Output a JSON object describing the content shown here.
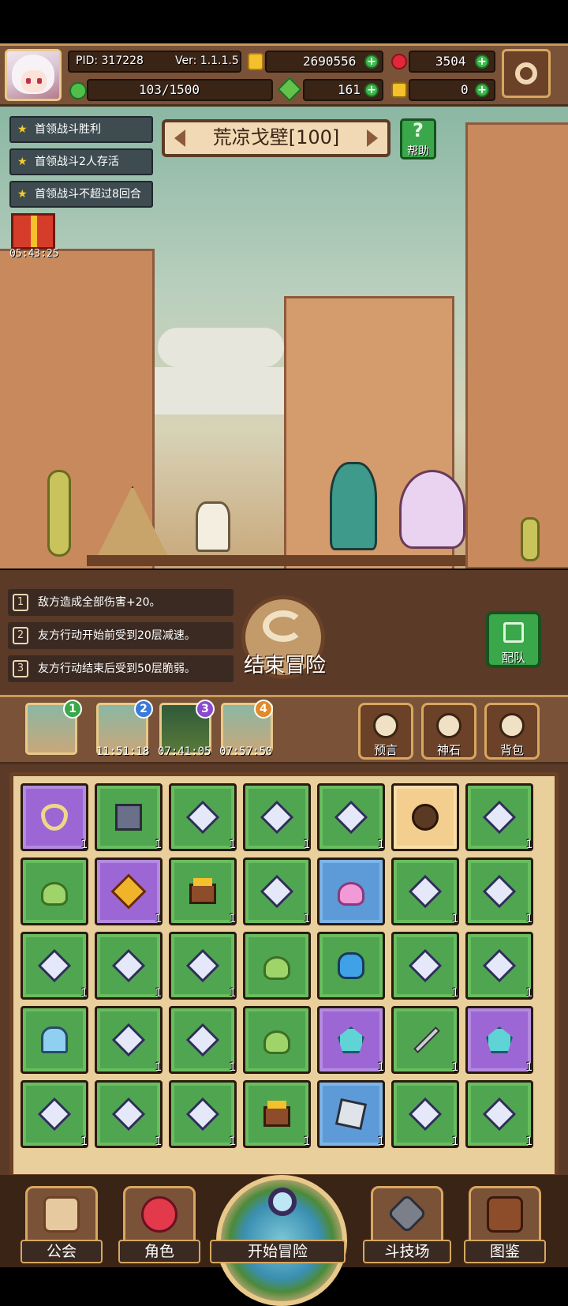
{
  "hud": {
    "pid": "PID: 317228",
    "version": "Ver: 1.1.1.5",
    "gold": "2690556",
    "gems": "3504",
    "energy": "103/1500",
    "clover": "161",
    "key": "0"
  },
  "quests": [
    {
      "label": "首领战斗胜利"
    },
    {
      "label": "首领战斗2人存活"
    },
    {
      "label": "首领战斗不超过8回合"
    }
  ],
  "stage": {
    "title": "荒凉戈壁[100]",
    "help_label": "帮助"
  },
  "gift_timer": "05:43:25",
  "rules": [
    {
      "n": "1",
      "text": "敌方造成全部伤害+20。"
    },
    {
      "n": "2",
      "text": "友方行动开始前受到20层减速。"
    },
    {
      "n": "3",
      "text": "友方行动结束后受到50层脆弱。"
    }
  ],
  "end_label": "结束冒险",
  "team_label": "配队",
  "slots": [
    {
      "n": "1",
      "timer": ""
    },
    {
      "n": "2",
      "timer": "11:51:18"
    },
    {
      "n": "3",
      "timer": "07:41:05"
    },
    {
      "n": "4",
      "timer": "07:57:50"
    }
  ],
  "side_buttons": [
    {
      "label": "预言"
    },
    {
      "label": "神石"
    },
    {
      "label": "背包"
    }
  ],
  "inventory": [
    {
      "bg": "purple",
      "icon": "necklace",
      "count": "1"
    },
    {
      "bg": "green",
      "icon": "book",
      "count": "1"
    },
    {
      "bg": "green",
      "icon": "crystal",
      "count": "1"
    },
    {
      "bg": "green",
      "icon": "crystal",
      "count": "1"
    },
    {
      "bg": "green",
      "icon": "crystal",
      "count": "1"
    },
    {
      "bg": "tan",
      "icon": "pot",
      "count": ""
    },
    {
      "bg": "green",
      "icon": "crystal",
      "count": "1"
    },
    {
      "bg": "green",
      "icon": "slime",
      "count": ""
    },
    {
      "bg": "purple",
      "icon": "gem4",
      "count": "1"
    },
    {
      "bg": "green",
      "icon": "chest",
      "count": "1"
    },
    {
      "bg": "green",
      "icon": "crystal",
      "count": "1"
    },
    {
      "bg": "blue",
      "icon": "slime-pink",
      "count": ""
    },
    {
      "bg": "green",
      "icon": "crystal",
      "count": "1"
    },
    {
      "bg": "green",
      "icon": "crystal",
      "count": "1"
    },
    {
      "bg": "green",
      "icon": "crystal",
      "count": "1"
    },
    {
      "bg": "green",
      "icon": "crystal",
      "count": "1"
    },
    {
      "bg": "green",
      "icon": "crystal",
      "count": "1"
    },
    {
      "bg": "green",
      "icon": "slime",
      "count": ""
    },
    {
      "bg": "green",
      "icon": "cat",
      "count": ""
    },
    {
      "bg": "green",
      "icon": "crystal",
      "count": "1"
    },
    {
      "bg": "green",
      "icon": "crystal",
      "count": "1"
    },
    {
      "bg": "green",
      "icon": "helm",
      "count": ""
    },
    {
      "bg": "green",
      "icon": "crystal",
      "count": "1"
    },
    {
      "bg": "green",
      "icon": "crystal",
      "count": "1"
    },
    {
      "bg": "green",
      "icon": "slime",
      "count": ""
    },
    {
      "bg": "purple",
      "icon": "shard",
      "count": "1"
    },
    {
      "bg": "green",
      "icon": "knife",
      "count": "1"
    },
    {
      "bg": "purple",
      "icon": "shard",
      "count": "1"
    },
    {
      "bg": "green",
      "icon": "crystal",
      "count": "1"
    },
    {
      "bg": "green",
      "icon": "crystal",
      "count": "1"
    },
    {
      "bg": "green",
      "icon": "crystal",
      "count": "1"
    },
    {
      "bg": "green",
      "icon": "chest",
      "count": "1"
    },
    {
      "bg": "blue",
      "icon": "cube",
      "count": "1"
    },
    {
      "bg": "green",
      "icon": "crystal",
      "count": "1"
    },
    {
      "bg": "green",
      "icon": "crystal",
      "count": "1"
    }
  ],
  "nav": {
    "guild": "公会",
    "character": "角色",
    "start": "开始冒险",
    "arena": "斗技场",
    "codex": "图鉴"
  }
}
